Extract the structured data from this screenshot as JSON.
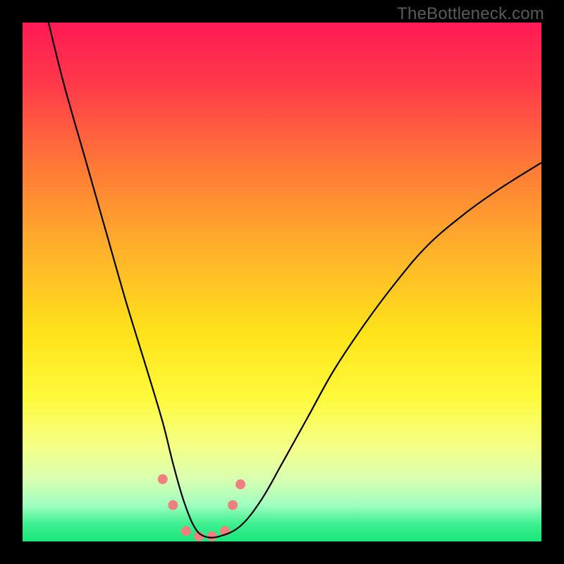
{
  "watermark": "TheBottleneck.com",
  "chart_data": {
    "type": "line",
    "title": "",
    "xlabel": "",
    "ylabel": "",
    "xlim": [
      0,
      100
    ],
    "ylim": [
      0,
      100
    ],
    "grid": false,
    "legend": false,
    "background": {
      "type": "vertical-gradient",
      "stops": [
        {
          "pos": 0.0,
          "color": "#ff1a55"
        },
        {
          "pos": 0.12,
          "color": "#ff3a4a"
        },
        {
          "pos": 0.28,
          "color": "#ff7a36"
        },
        {
          "pos": 0.45,
          "color": "#ffb52a"
        },
        {
          "pos": 0.6,
          "color": "#ffe31a"
        },
        {
          "pos": 0.72,
          "color": "#fff93a"
        },
        {
          "pos": 0.82,
          "color": "#f4ff8a"
        },
        {
          "pos": 0.88,
          "color": "#d8ffb0"
        },
        {
          "pos": 0.93,
          "color": "#a0ffc0"
        },
        {
          "pos": 0.965,
          "color": "#40f090"
        },
        {
          "pos": 1.0,
          "color": "#17e67a"
        }
      ]
    },
    "series": [
      {
        "name": "bottleneck-curve",
        "color": "#000000",
        "x": [
          5,
          8,
          12,
          16,
          20,
          24,
          27,
          29,
          31,
          33,
          35,
          38,
          42,
          46,
          50,
          55,
          60,
          66,
          72,
          78,
          85,
          92,
          100
        ],
        "y": [
          100,
          88,
          74,
          60,
          46,
          33,
          23,
          15,
          8,
          3,
          1,
          1,
          3,
          8,
          15,
          24,
          33,
          42,
          50,
          57,
          63,
          68,
          73
        ]
      }
    ],
    "markers": {
      "name": "highlight-dots",
      "color": "#f08080",
      "radius": 7,
      "points": [
        {
          "x": 27,
          "y": 12
        },
        {
          "x": 29,
          "y": 7
        },
        {
          "x": 31.5,
          "y": 2
        },
        {
          "x": 34,
          "y": 1
        },
        {
          "x": 36.5,
          "y": 1
        },
        {
          "x": 39,
          "y": 2
        },
        {
          "x": 40.5,
          "y": 7
        },
        {
          "x": 42,
          "y": 11
        }
      ]
    }
  }
}
